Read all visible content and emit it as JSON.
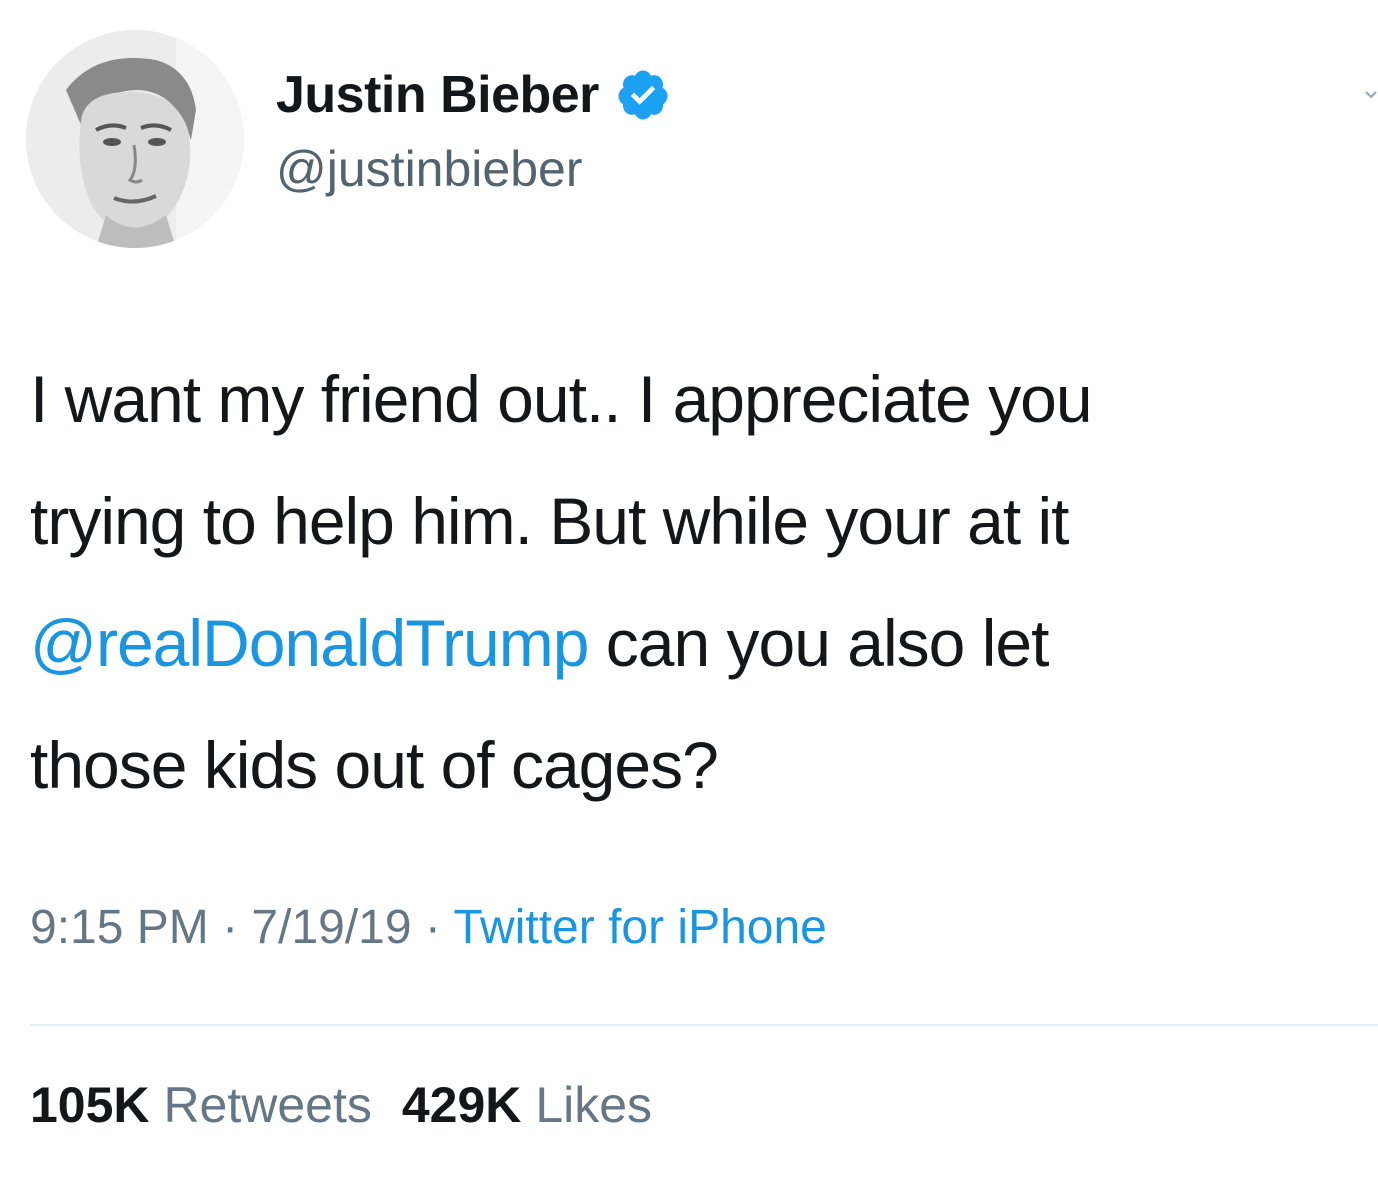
{
  "author": {
    "display_name": "Justin Bieber",
    "handle": "@justinbieber",
    "verified": true,
    "avatar_icon": "profile-photo"
  },
  "tweet": {
    "lines": [
      {
        "text": "I want my friend out.. I appreciate you"
      },
      {
        "text": "trying to help him. But while your at it"
      },
      {
        "mention": "@realDonaldTrump",
        "text": " can you also let"
      },
      {
        "text": "those kids out of cages?"
      }
    ]
  },
  "meta": {
    "time": "9:15 PM",
    "separator": " · ",
    "date": "7/19/19",
    "source": "Twitter for iPhone"
  },
  "stats": {
    "retweets_count": "105K",
    "retweets_label": "Retweets",
    "likes_count": "429K",
    "likes_label": "Likes"
  },
  "colors": {
    "link": "#1b95e0",
    "verified_badge": "#1da1f2",
    "text": "#14171a",
    "muted": "#657786"
  }
}
